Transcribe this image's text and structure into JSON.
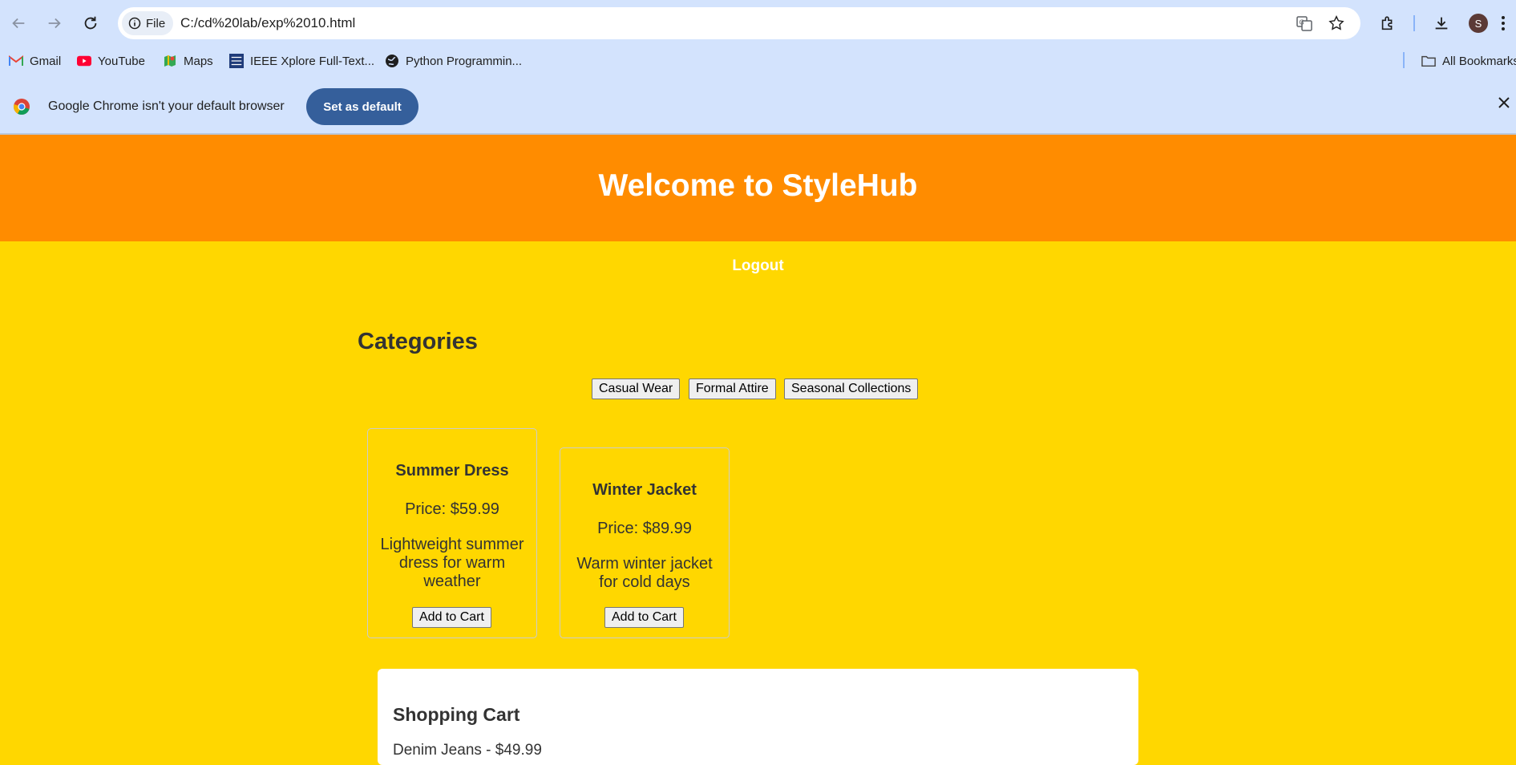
{
  "browser": {
    "url": "C:/cd%20lab/exp%2010.html",
    "site_chip": "File",
    "avatar_letter": "S",
    "bookmarks": [
      {
        "label": "Gmail",
        "icon": "gmail-icon"
      },
      {
        "label": "YouTube",
        "icon": "youtube-icon"
      },
      {
        "label": "Maps",
        "icon": "maps-icon"
      },
      {
        "label": "IEEE Xplore Full-Text...",
        "icon": "ieee-icon"
      },
      {
        "label": "Python Programmin...",
        "icon": "globe-icon"
      }
    ],
    "all_bookmarks": "All Bookmarks",
    "infobar": {
      "message": "Google Chrome isn't your default browser",
      "button": "Set as default"
    }
  },
  "site": {
    "title": "Welcome to StyleHub",
    "logout": "Logout",
    "categories_heading": "Categories",
    "categories": [
      "Casual Wear",
      "Formal Attire",
      "Seasonal Collections"
    ],
    "products": [
      {
        "name": "Summer Dress",
        "price": "Price: $59.99",
        "description": "Lightweight summer dress for warm weather",
        "button": "Add to Cart"
      },
      {
        "name": "Winter Jacket",
        "price": "Price: $89.99",
        "description": "Warm winter jacket for cold days",
        "button": "Add to Cart"
      }
    ],
    "cart": {
      "title": "Shopping Cart",
      "items": [
        "Denim Jeans - $49.99"
      ]
    }
  },
  "colors": {
    "chrome_bg": "#d3e3fd",
    "header_bg": "#ff8c00",
    "page_bg": "#ffd700",
    "set_default_bg": "#355f9b"
  }
}
